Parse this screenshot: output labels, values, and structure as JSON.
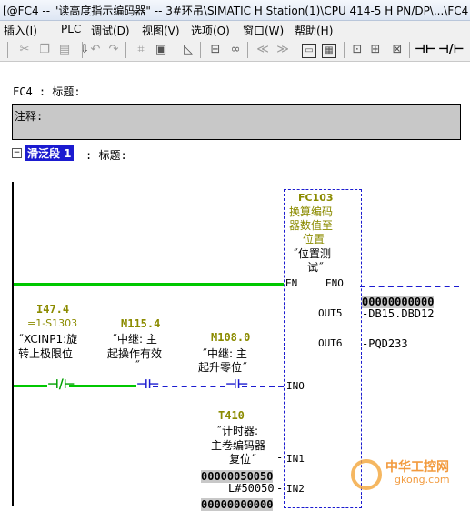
{
  "window": {
    "title": "[@FC4 -- \"读高度指示编码器\" -- 3#环吊\\SIMATIC H Station(1)\\CPU 414-5 H PN/DP\\...\\FC4  c"
  },
  "menu": [
    "插入(I)",
    "PLC",
    "调试(D)",
    "视图(V)",
    "选项(O)",
    "窗口(W)",
    "帮助(H)"
  ],
  "toolbar": {
    "icons": [
      "cut-icon",
      "copy-icon",
      "paste-icon",
      "download-icon",
      "undo-icon",
      "redo-icon",
      "monitor-icon",
      "load-icon",
      "view-icon",
      "ladder-icon",
      "glasses-icon",
      "jump-icon",
      "jump-end-icon",
      "block-icon",
      "overview-icon",
      "contact-icon",
      "nc-contact-icon"
    ]
  },
  "editor": {
    "block_header": "FC4 : 标题:",
    "comment_label": "注释:",
    "network_title": "滑泛段 1",
    "network_title_suffix": ": 标题:",
    "fc": {
      "name": "FC103",
      "comment": [
        "换算编码",
        "器数值至",
        "位置"
      ],
      "symbol": [
        "˝位置测",
        "试˝"
      ],
      "pin_en": "EN",
      "pin_eno": "ENO",
      "pin_out5": "OUT5",
      "pin_out6": "OUT6",
      "pin_ino": "INO",
      "pin_in1": "IN1",
      "pin_in2": "IN2"
    },
    "out5_value": "00000000000",
    "out5_addr": "-DB15.DBD12",
    "out6_addr": "-PQD233",
    "contacts": [
      {
        "addr": "I47.4",
        "symbol": "=1-S1303",
        "comment": [
          "˝XCINP1:旋",
          "转上极限位"
        ]
      },
      {
        "addr": "M115.4",
        "comment": [
          "˝中继: 主",
          "起操作有效",
          "˝"
        ]
      },
      {
        "addr": "M108.0",
        "comment": [
          "˝中继: 主",
          "起升零位˝"
        ]
      }
    ],
    "timer": {
      "addr": "T410",
      "comment": [
        "˝计时器:",
        "主卷编码器",
        "复位˝"
      ]
    },
    "in1_value": "00000050050",
    "in2_label": "L#50050",
    "bottom_value": "00000000000"
  },
  "watermark": {
    "text": "中华工控网",
    "url": "gkong.com"
  }
}
